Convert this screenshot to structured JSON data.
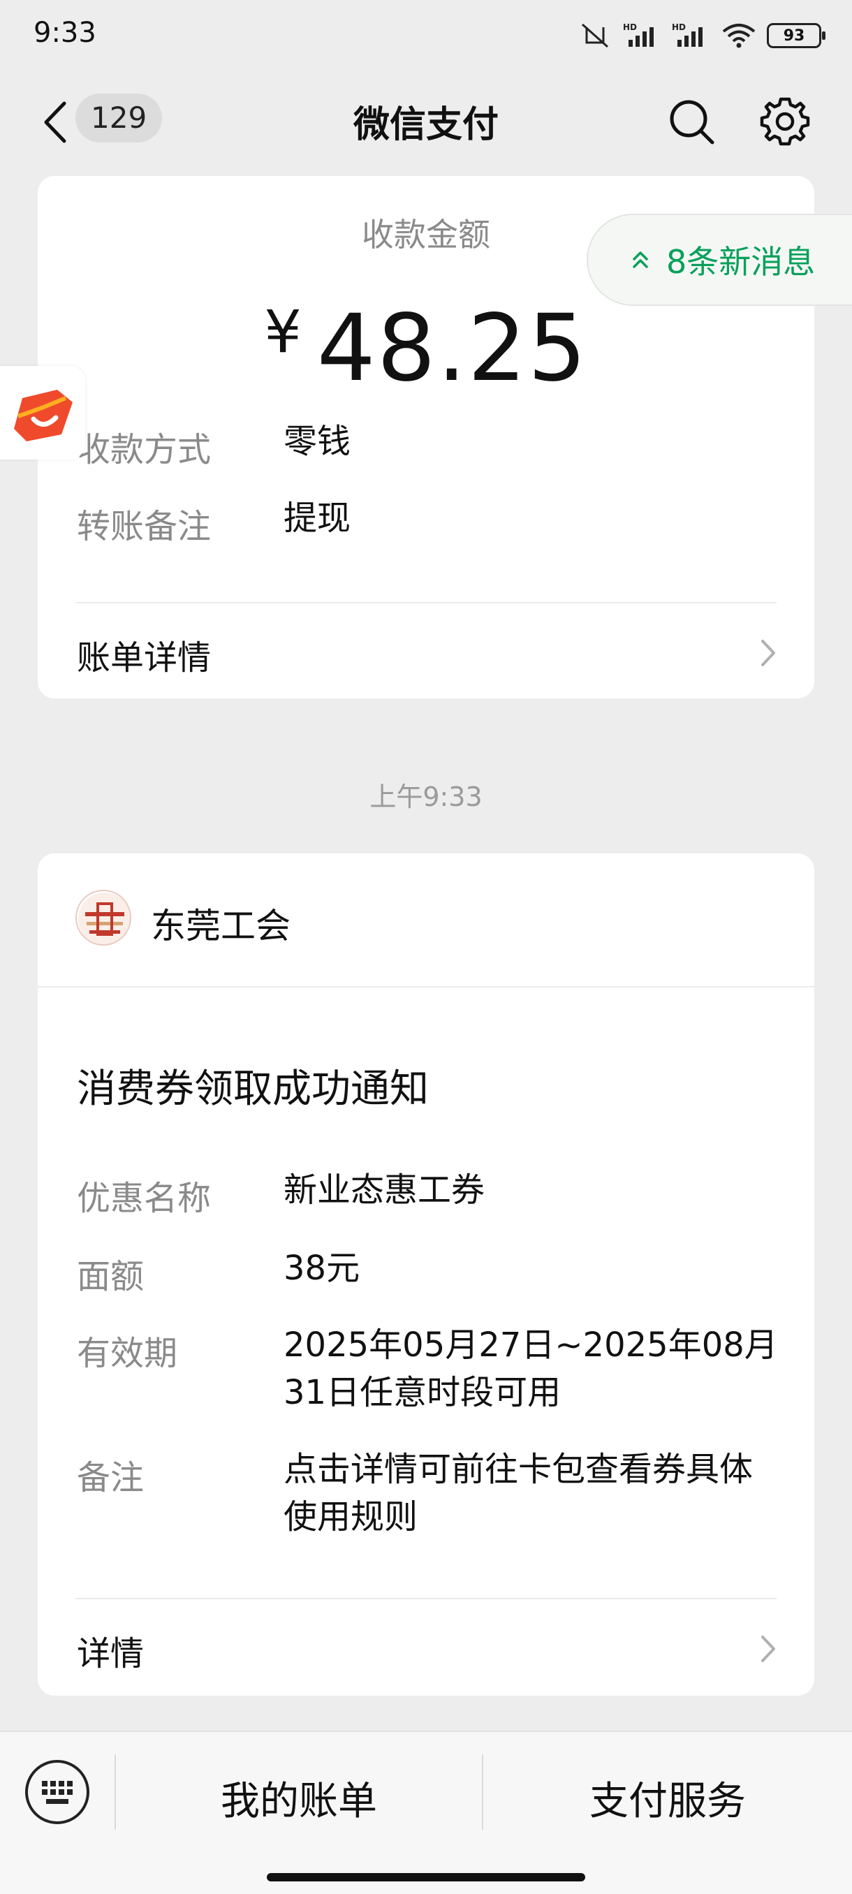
{
  "status_bar": {
    "time": "9:33",
    "battery": "93"
  },
  "header": {
    "unread_count": "129",
    "title": "微信支付"
  },
  "payment_card": {
    "amount_label": "收款金额",
    "currency_symbol": "¥",
    "amount": "48.25",
    "rows": [
      {
        "label": "收款方式",
        "value": "零钱"
      },
      {
        "label": "转账备注",
        "value": "提现"
      }
    ],
    "detail_link": "账单详情"
  },
  "new_messages": "8条新消息",
  "timestamp": "上午9:33",
  "notice_card": {
    "org_name": "东莞工会",
    "title": "消费券领取成功通知",
    "rows": [
      {
        "label": "优惠名称",
        "value": "新业态惠工券"
      },
      {
        "label": "面额",
        "value": "38元"
      },
      {
        "label": "有效期",
        "value": "2025年05月27日~2025年08月31日任意时段可用"
      },
      {
        "label": "备注",
        "value": "点击详情可前往卡包查看券具体使用规则"
      }
    ],
    "detail_link": "详情"
  },
  "bottom_bar": {
    "item1": "我的账单",
    "item2": "支付服务"
  },
  "colors": {
    "accent_green": "#07a05a",
    "background": "#ededed"
  },
  "icons": [
    "back-icon",
    "search-icon",
    "gear-icon",
    "chevron-right-icon",
    "keyboard-icon",
    "double-chevron-up-icon"
  ]
}
